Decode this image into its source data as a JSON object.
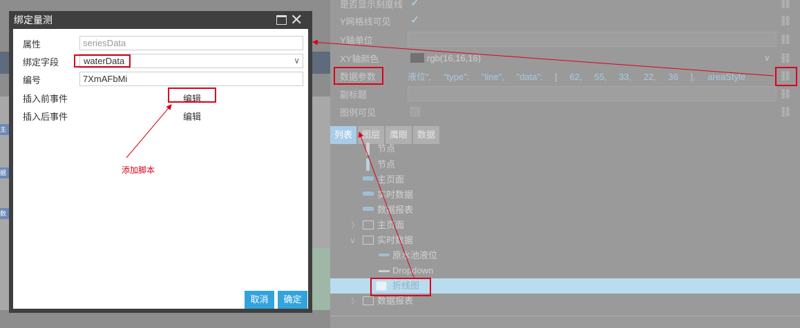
{
  "dialog": {
    "title": "绑定量测",
    "fields": {
      "property_label": "属性",
      "property_value": "seriesData",
      "bind_field_label": "绑定字段",
      "bind_field_value": "waterData",
      "id_label": "编号",
      "id_value": "7XmAFbMi",
      "before_insert_label": "插入前事件",
      "before_insert_link": "编辑",
      "after_insert_label": "插入后事件",
      "after_insert_link": "编辑"
    },
    "buttons": {
      "cancel": "取消",
      "ok": "确定"
    }
  },
  "annotation": {
    "add_script": "添加脚本"
  },
  "properties": {
    "row_scale_line": "是否显示刻度线",
    "row_y_grid": "Y网格线可见",
    "row_y_unit": "Y轴单位",
    "row_xy_color": "XY轴颜色",
    "xy_color_value": "rgb(16,16,16)",
    "row_data_params": "数据参数",
    "data_params_value": "液位\", \"type\": \"line\", \"data\": [ 62, 55, 33, 22, 36 ], areaStyle",
    "row_subtitle": "副标题",
    "row_legend": "图例可见"
  },
  "tabs": [
    "列表",
    "图层",
    "鹰眼",
    "数据"
  ],
  "tree": {
    "items": [
      {
        "label": "节点"
      },
      {
        "label": "节点"
      },
      {
        "label": "主页面"
      },
      {
        "label": "实时数据"
      },
      {
        "label": "数据报表"
      },
      {
        "label": "主页面"
      },
      {
        "label": "实时数据"
      },
      {
        "label": "原水池液位"
      },
      {
        "label": "Dropdown"
      },
      {
        "label": "折线图"
      },
      {
        "label": "数据报表"
      }
    ]
  },
  "background_nodes": [
    "主",
    "据",
    "数"
  ],
  "colors": {
    "annotation_red": "#d9001b",
    "button_blue": "#33a3dc",
    "selected_row": "#b9dcee"
  }
}
